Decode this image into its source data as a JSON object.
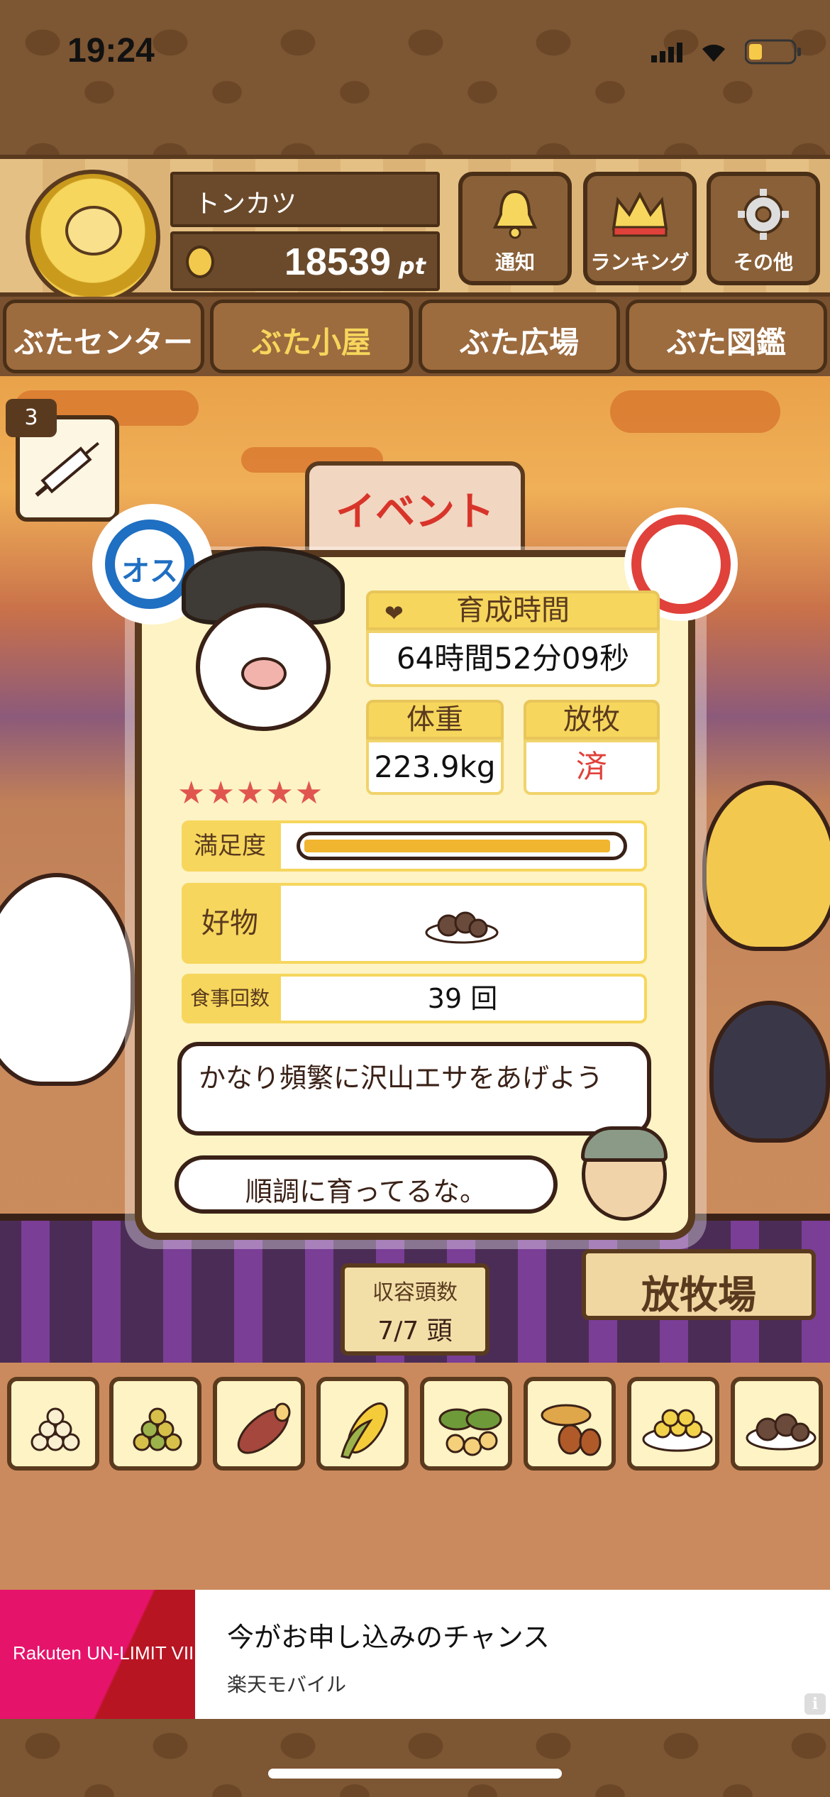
{
  "status_bar": {
    "time": "19:24"
  },
  "header": {
    "player_name": "トンカツ",
    "points_value": "18539",
    "points_unit": "pt",
    "buttons": [
      {
        "label": "通知",
        "icon": "bell-icon"
      },
      {
        "label": "ランキング",
        "icon": "crown-icon"
      },
      {
        "label": "その他",
        "icon": "gear-icon"
      }
    ]
  },
  "nav": {
    "tabs": [
      {
        "label": "ぶたセンター"
      },
      {
        "label": "ぶた小屋",
        "active": true
      },
      {
        "label": "ぶた広場"
      },
      {
        "label": "ぶた図鑑"
      }
    ]
  },
  "scene": {
    "syringe_count": "3",
    "event_sign": "イベント"
  },
  "pig_card": {
    "gender_label": "オス",
    "rating": "★★★★★",
    "raising_time_label": "育成時間",
    "raising_time_value": "64時間52分09秒",
    "weight_label": "体重",
    "weight_value": "223.9kg",
    "pasture_label": "放牧",
    "pasture_value": "済",
    "satisfaction_label": "満足度",
    "satisfaction_level": 0.97,
    "favorite_label": "好物",
    "favorite_icon": "meatball-dish-icon",
    "meals_label": "食事回数",
    "meals_value": "39 回",
    "advice_text": "かなり頻繁に沢山エサをあげよう",
    "comment_text": "順調に育ってるな。"
  },
  "capacity": {
    "label": "収容頭数",
    "value": "7/7 頭"
  },
  "pasture_sign": "放牧場",
  "food_slots": [
    {
      "icon": "grain-pile-white-icon"
    },
    {
      "icon": "grain-pile-green-icon"
    },
    {
      "icon": "sweet-potato-icon"
    },
    {
      "icon": "corn-icon"
    },
    {
      "icon": "beans-leaves-icon"
    },
    {
      "icon": "acorn-icon"
    },
    {
      "icon": "soybean-dish-icon"
    },
    {
      "icon": "meatball-dish-icon"
    }
  ],
  "ad": {
    "brand": "Rakuten UN-LIMIT VII",
    "title": "今がお申し込みのチャンス",
    "subtitle": "楽天モバイル"
  },
  "colors": {
    "accent": "#f6d65c",
    "wood": "#5a3a1e",
    "male_blue": "#1f6fc2",
    "done_red": "#e0413a"
  }
}
